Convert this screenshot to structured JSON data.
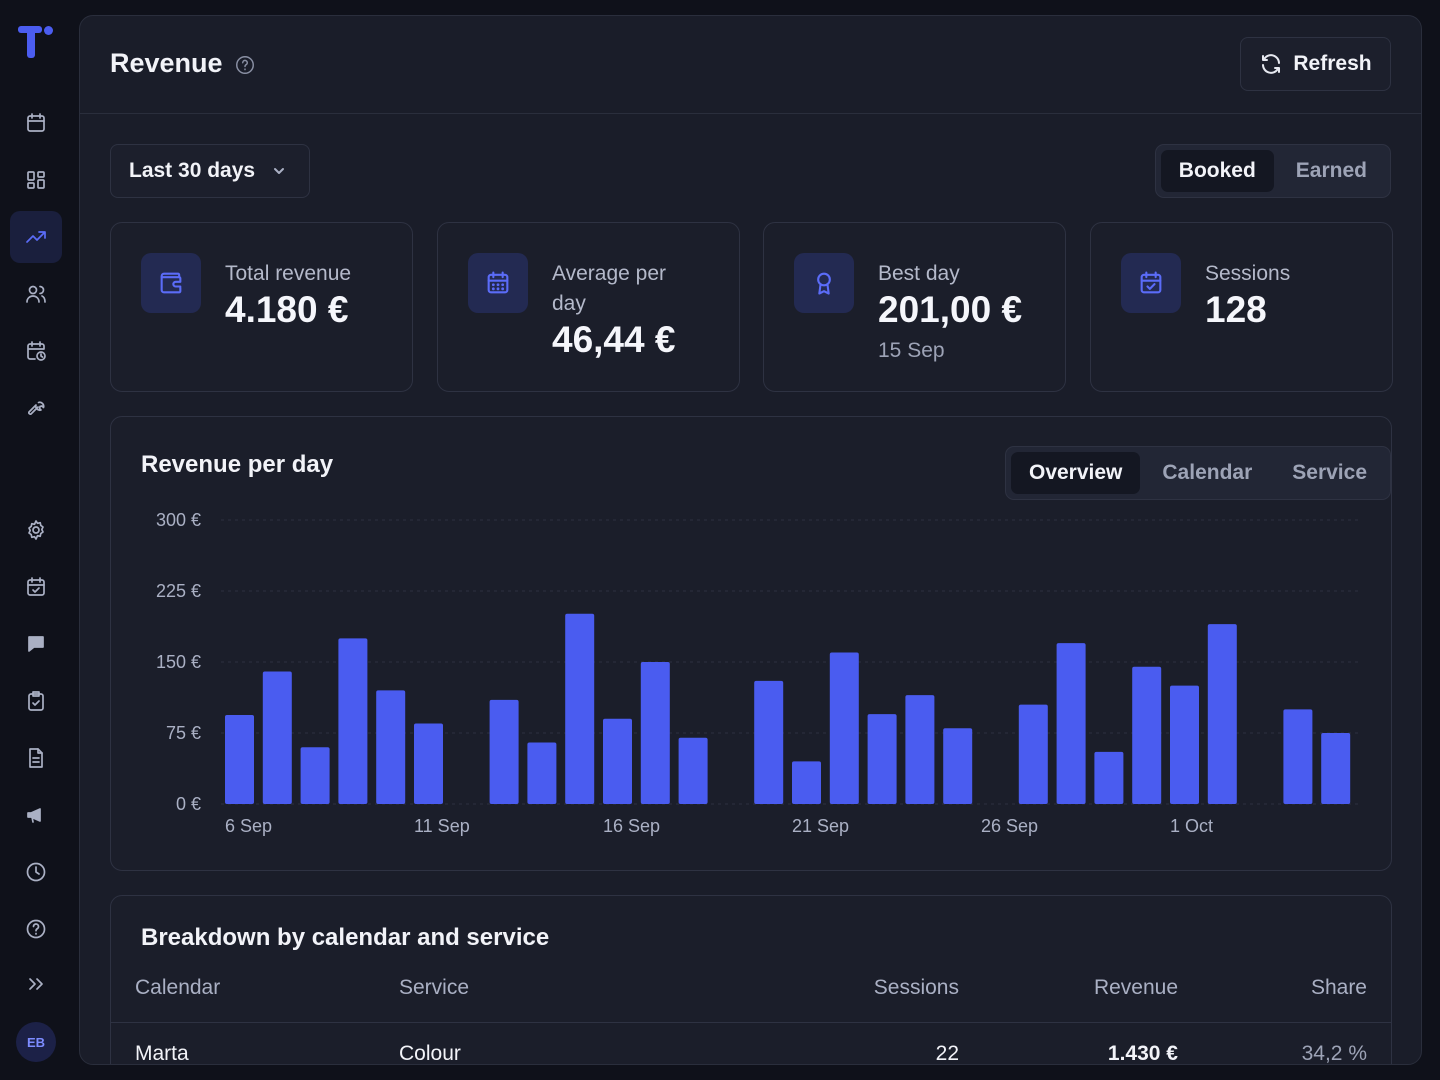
{
  "sidebar": {
    "items": [
      {
        "icon": "calendar-icon"
      },
      {
        "icon": "dashboard-icon"
      },
      {
        "icon": "trending-up-icon",
        "active": true
      },
      {
        "icon": "users-icon"
      },
      {
        "icon": "calendar-clock-icon"
      },
      {
        "icon": "wrench-icon"
      },
      {
        "icon": "gear-icon"
      },
      {
        "icon": "calendar-check-icon"
      },
      {
        "icon": "chat-icon"
      },
      {
        "icon": "clipboard-check-icon"
      },
      {
        "icon": "document-icon"
      },
      {
        "icon": "megaphone-icon"
      },
      {
        "icon": "clock-icon"
      },
      {
        "icon": "help-icon"
      },
      {
        "icon": "expand-icon"
      }
    ],
    "avatar_initials": "EB"
  },
  "header": {
    "title": "Revenue",
    "refresh_label": "Refresh"
  },
  "filters": {
    "range_value": "Last 30 days",
    "mode_options": [
      "Booked",
      "Earned"
    ],
    "mode_selected": "Booked"
  },
  "stats": [
    {
      "label": "Total revenue",
      "value": "4.180 €",
      "icon": "wallet-icon"
    },
    {
      "label": "Average per day",
      "value": "46,44 €",
      "icon": "calendar-grid-icon"
    },
    {
      "label": "Best day",
      "value": "201,00 €",
      "sub": "15 Sep",
      "icon": "award-icon"
    },
    {
      "label": "Sessions",
      "value": "128",
      "icon": "calendar-check-icon"
    }
  ],
  "chart": {
    "title": "Revenue per day",
    "view_options": [
      "Overview",
      "Calendar",
      "Service"
    ],
    "view_selected": "Overview"
  },
  "chart_data": {
    "type": "bar",
    "x_tick_labels": [
      "6 Sep",
      "11 Sep",
      "16 Sep",
      "21 Sep",
      "26 Sep",
      "1 Oct"
    ],
    "y_tick_labels": [
      "0 €",
      "75 €",
      "150 €",
      "225 €",
      "300 €"
    ],
    "ylim": [
      0,
      300
    ],
    "bar_color": "#4a5cf0",
    "categories": [
      "6 Sep",
      "7 Sep",
      "8 Sep",
      "9 Sep",
      "10 Sep",
      "11 Sep",
      "12 Sep",
      "13 Sep",
      "14 Sep",
      "15 Sep",
      "16 Sep",
      "17 Sep",
      "18 Sep",
      "19 Sep",
      "20 Sep",
      "21 Sep",
      "22 Sep",
      "23 Sep",
      "24 Sep",
      "25 Sep",
      "26 Sep",
      "27 Sep",
      "28 Sep",
      "29 Sep",
      "30 Sep",
      "1 Oct",
      "2 Oct",
      "3 Oct",
      "4 Oct",
      "5 Oct",
      "6 Oct"
    ],
    "values": [
      94,
      140,
      60,
      175,
      120,
      85,
      0,
      110,
      65,
      201,
      90,
      150,
      70,
      0,
      130,
      45,
      160,
      95,
      115,
      80,
      0,
      105,
      170,
      55,
      145,
      125,
      190,
      0,
      100,
      75,
      0
    ]
  },
  "breakdown": {
    "title": "Breakdown by calendar and service",
    "columns": [
      "Calendar",
      "Service",
      "Sessions",
      "Revenue",
      "Share"
    ],
    "rows": [
      [
        "Marta",
        "Colour",
        "22",
        "1.430 €",
        "34,2 %"
      ]
    ]
  }
}
